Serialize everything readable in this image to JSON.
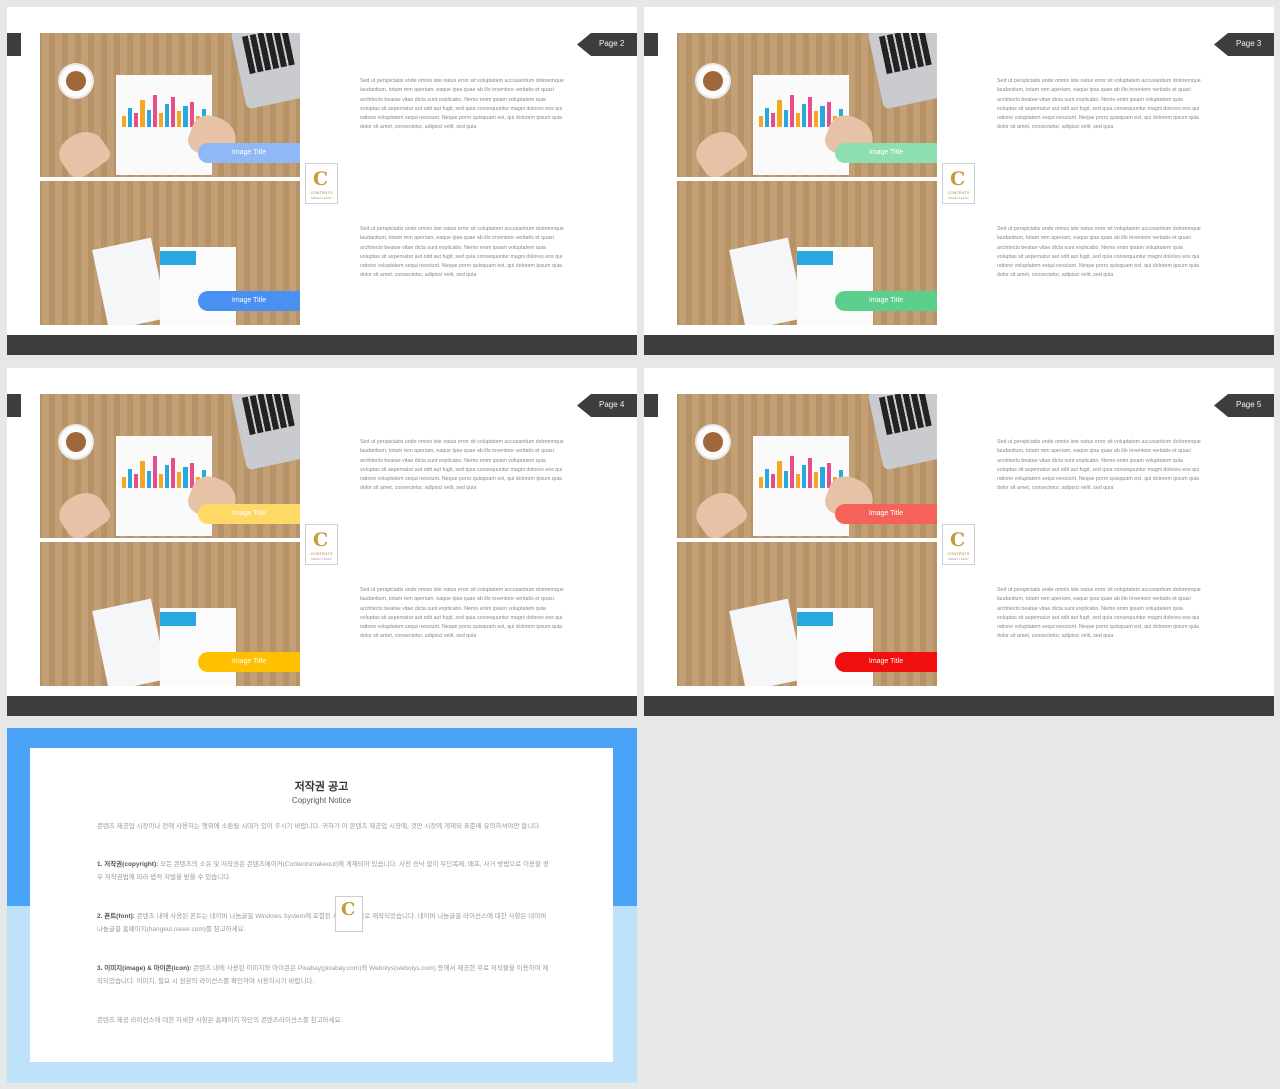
{
  "slides": [
    {
      "page": "Page 2",
      "image_title_1": "Image   Title",
      "image_title_2": "Image   Title",
      "pill_color_1": "#8fb8f5",
      "pill_color_2": "#4a90f0"
    },
    {
      "page": "Page 3",
      "image_title_1": "Image   Title",
      "image_title_2": "Image   Title",
      "pill_color_1": "#8edfb0",
      "pill_color_2": "#5ccf8c"
    },
    {
      "page": "Page 4",
      "image_title_1": "Image   Title",
      "image_title_2": "Image   Title",
      "pill_color_1": "#ffd966",
      "pill_color_2": "#ffc000"
    },
    {
      "page": "Page 5",
      "image_title_1": "Image   Title",
      "image_title_2": "Image   Title",
      "pill_color_1": "#f5625a",
      "pill_color_2": "#f01010"
    }
  ],
  "body_text": "Sed ut perspiciatis unde omnis iste natus error sit voluptatem accusantium doloremque laudantium, totam rem aperiam, eaque ipsa quae ab illo inventore veritatis et quasi architecto beatae vitae dicta sunt explicabo. Nemo enim ipsam voluptatem quia voluptas sit aspernatur aut odit aut fugit, sed quia consequuntur magni dolores eos qui ratione voluptatem sequi nesciunt. Neque porro quisquam est, qui dolorem ipsum quia dolor sit amet, consectetur, adipisci velit, sed quia",
  "logo": {
    "letter": "C",
    "name": "CONTENTS",
    "tagline": "MAKE IT EASY"
  },
  "colors": {
    "dark_bar": "#3d3d3d",
    "copyright_blue": "#4aa3f6",
    "copyright_light": "#bfe2fb",
    "gold": "#c79a3c"
  },
  "copyright": {
    "title": "저작권 공고",
    "subtitle": "Copyright Notice",
    "intro": "콘텐츠 제공업 시장이나 전에 사용하는 행위에 소환될 시대가 있어 주시기 바랍니다. 귀하가 이 콘텐츠 제공업 시장에, 것만 시장에 게재되 표준에 유의하셔야만 합니다.",
    "s1_label": "1. 저작권(copyright):",
    "s1_text": " 모든 콘텐츠의 소유 및 저작권은 콘텐츠메이커(Contentsmakeout)에 게재되어 있습니다. 사전 승낙 없이 무단복제, 배포, 사거 방법으로 이용할 경우 저작권법에 따라 법적 처벌을 받을 수 있습니다.",
    "s2_label": "2. 폰트(font):",
    "s2_text": " 콘텐츠 내에 사용된 폰트는 네이버 나눔글꼴 Windows System에 포함된 시스템 글꼴로 제작되었습니다. 네이버 나눔글꼴 라이선스에 대한 사항은 네이버 나눔글꼴 홈페이지(hangeul.naver.com)를 참고하세요.",
    "s3_label": "3. 이미지(image) & 아이콘(icon):",
    "s3_text": " 콘텐츠 내에 사용된 이미지와 아이콘은 Pixabay(pixabay.com)와 Webolys(webolys.com) 등에서 제공한 무료 저작물을 이용하여 제작되었습니다. 이미지, 필요 시 원본의 라이선스를 확인하여 사용하시기 바랍니다.",
    "outro": "콘텐츠 제공 라이선스에 대한 자세한 사항은 홈페이지 하단의 콘텐츠라이선스를 참고하세요."
  }
}
